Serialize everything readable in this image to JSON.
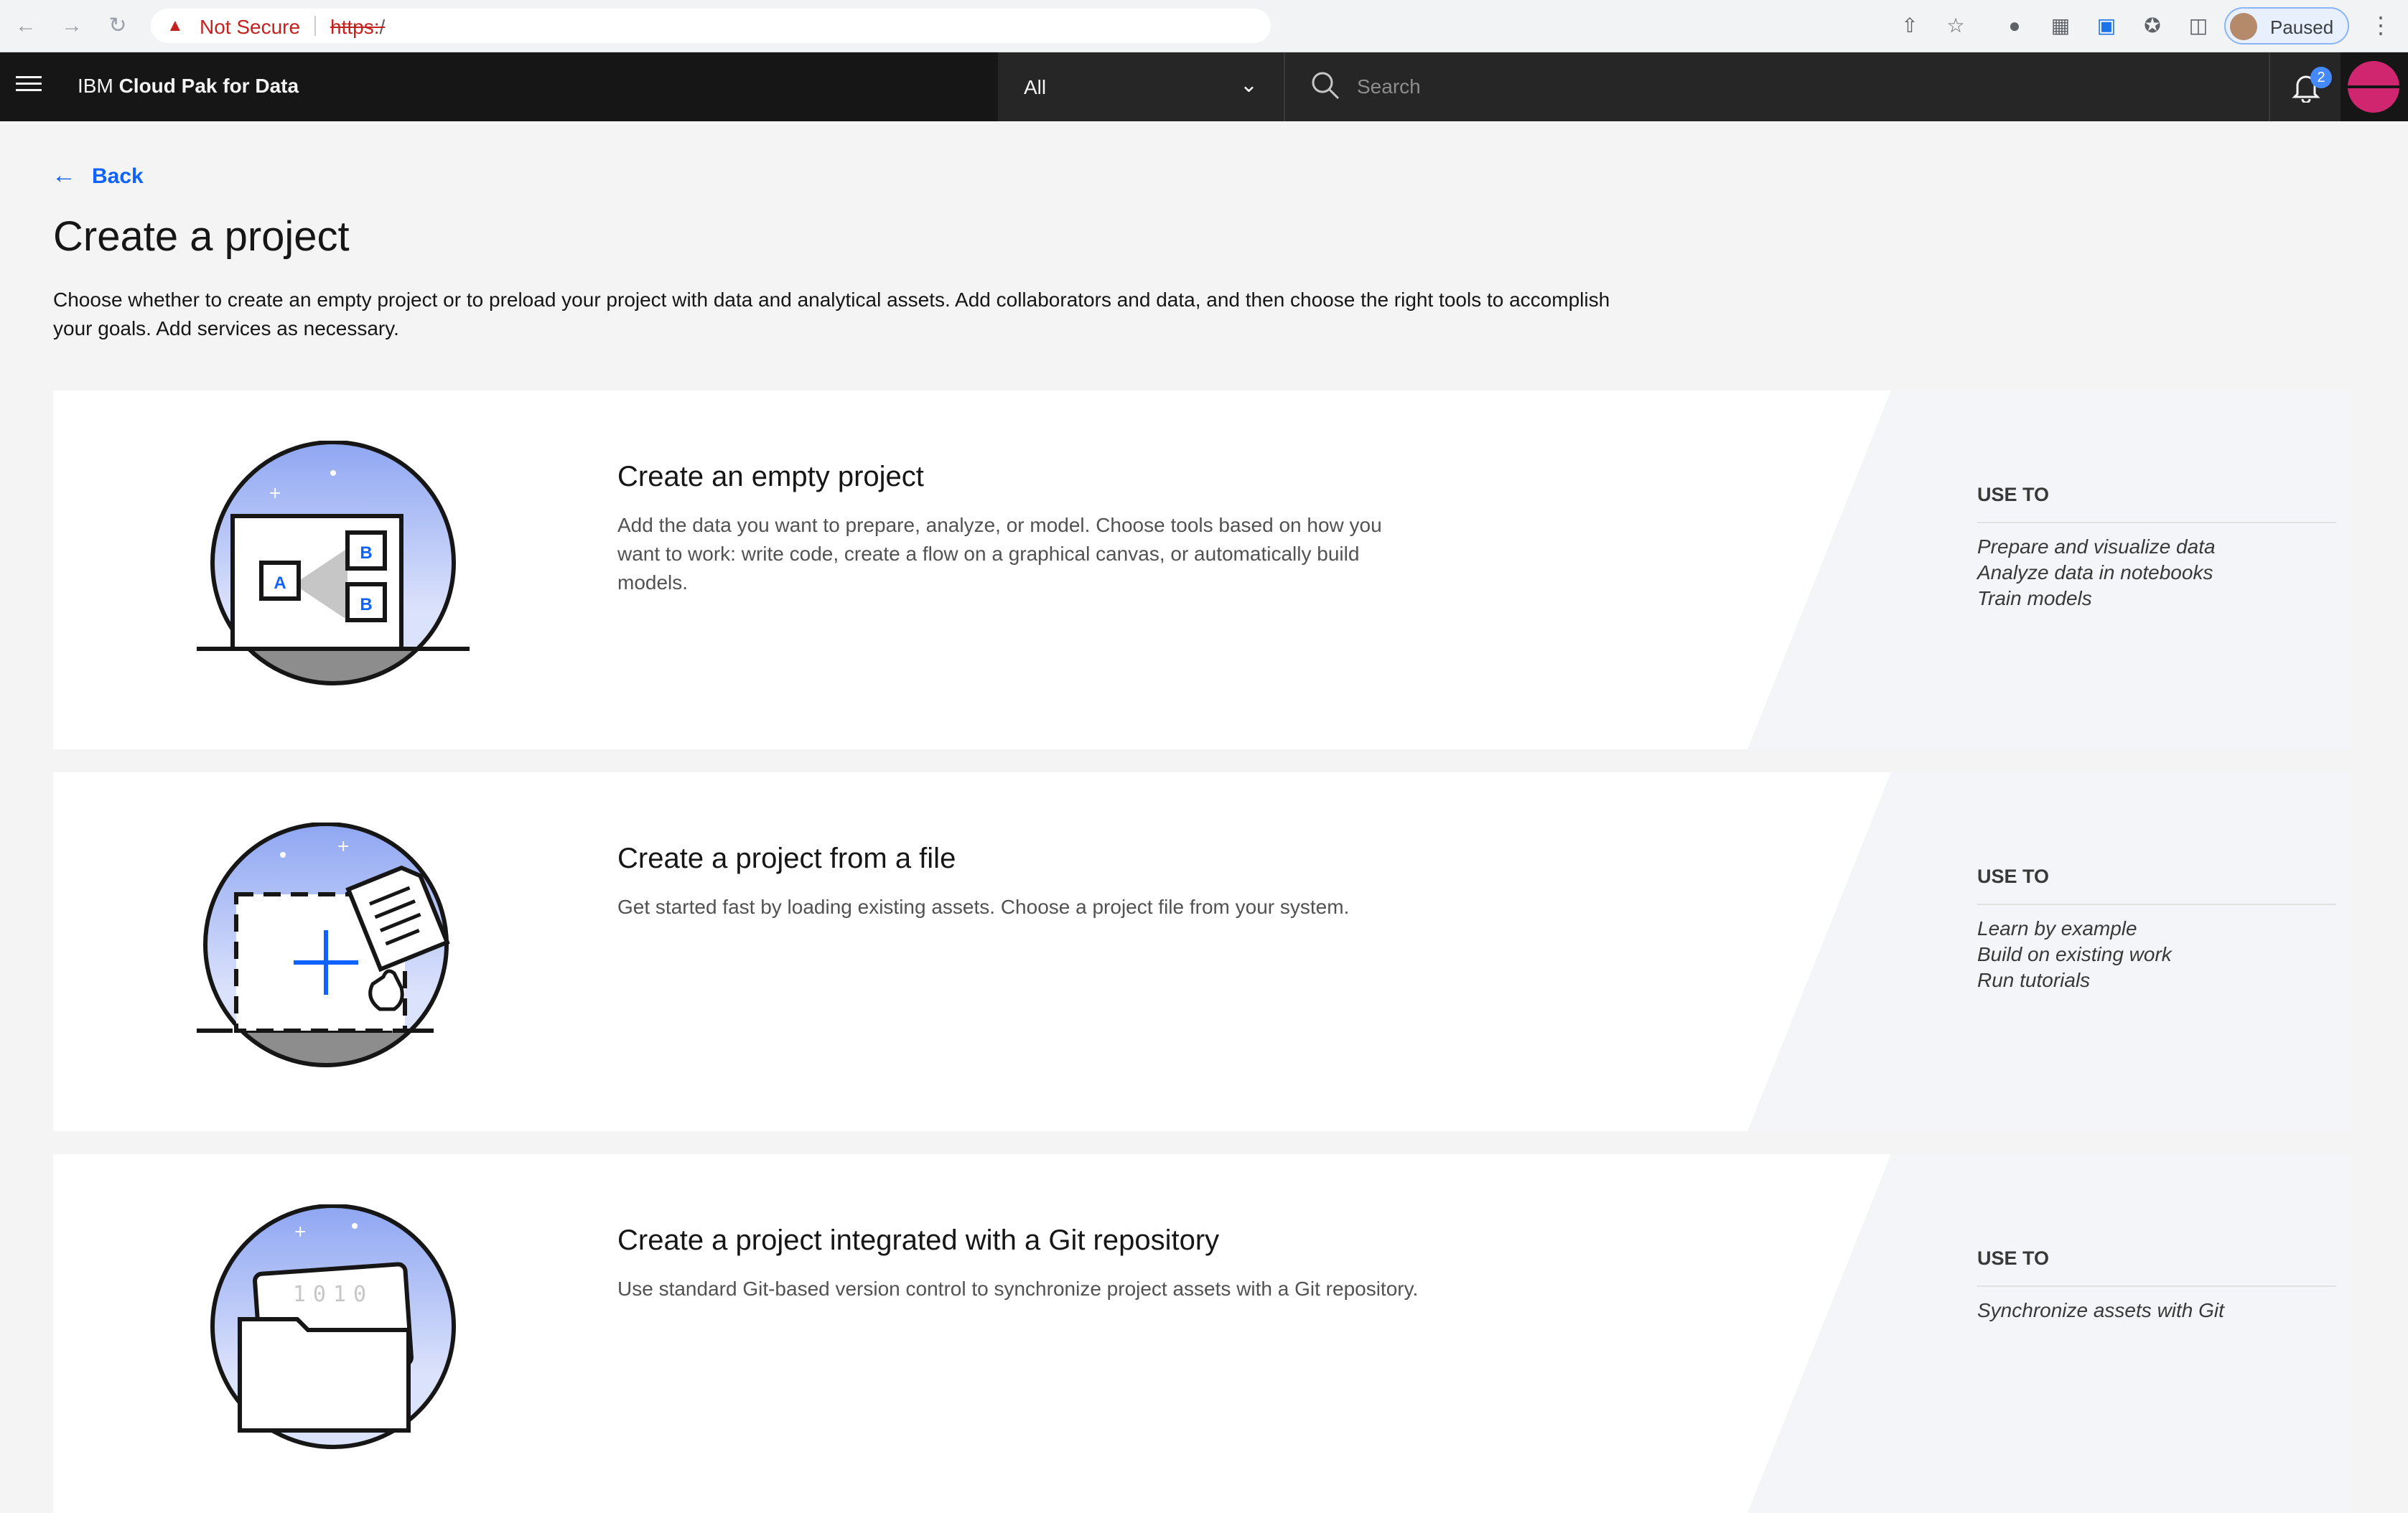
{
  "browser": {
    "security_label": "Not Secure",
    "url_scheme": "https:",
    "url_rest": "/",
    "profile_label": "Paused"
  },
  "header": {
    "brand_prefix": "IBM",
    "brand_name": "Cloud Pak for Data",
    "scope_value": "All",
    "search_placeholder": "Search",
    "notification_count": "2"
  },
  "page": {
    "back_label": "Back",
    "title": "Create a project",
    "description": "Choose whether to create an empty project or to preload your project with data and analytical assets. Add collaborators and data, and then choose the right tools to accomplish your goals. Add services as necessary."
  },
  "tiles": [
    {
      "title": "Create an empty project",
      "description": "Add the data you want to prepare, analyze, or model. Choose tools based on how you want to work: write code, create a flow on a graphical canvas, or automatically build models.",
      "use_to_label": "USE TO",
      "uses": [
        "Prepare and visualize data",
        "Analyze data in notebooks",
        "Train models"
      ]
    },
    {
      "title": "Create a project from a file",
      "description": "Get started fast by loading existing assets. Choose a project file from your system.",
      "use_to_label": "USE TO",
      "uses": [
        "Learn by example",
        "Build on existing work",
        "Run tutorials"
      ]
    },
    {
      "title": "Create a project integrated with a Git repository",
      "description": "Use standard Git-based version control to synchronize project assets with a Git repository.",
      "use_to_label": "USE TO",
      "uses": [
        "Synchronize assets with Git"
      ]
    }
  ],
  "illustration_text": {
    "box_a": "A",
    "box_b": "B",
    "binary": "1010"
  },
  "colors": {
    "brand_blue": "#0f62fe",
    "header_bg": "#161616",
    "avatar": "#d02670",
    "warning_red": "#c5221f"
  }
}
